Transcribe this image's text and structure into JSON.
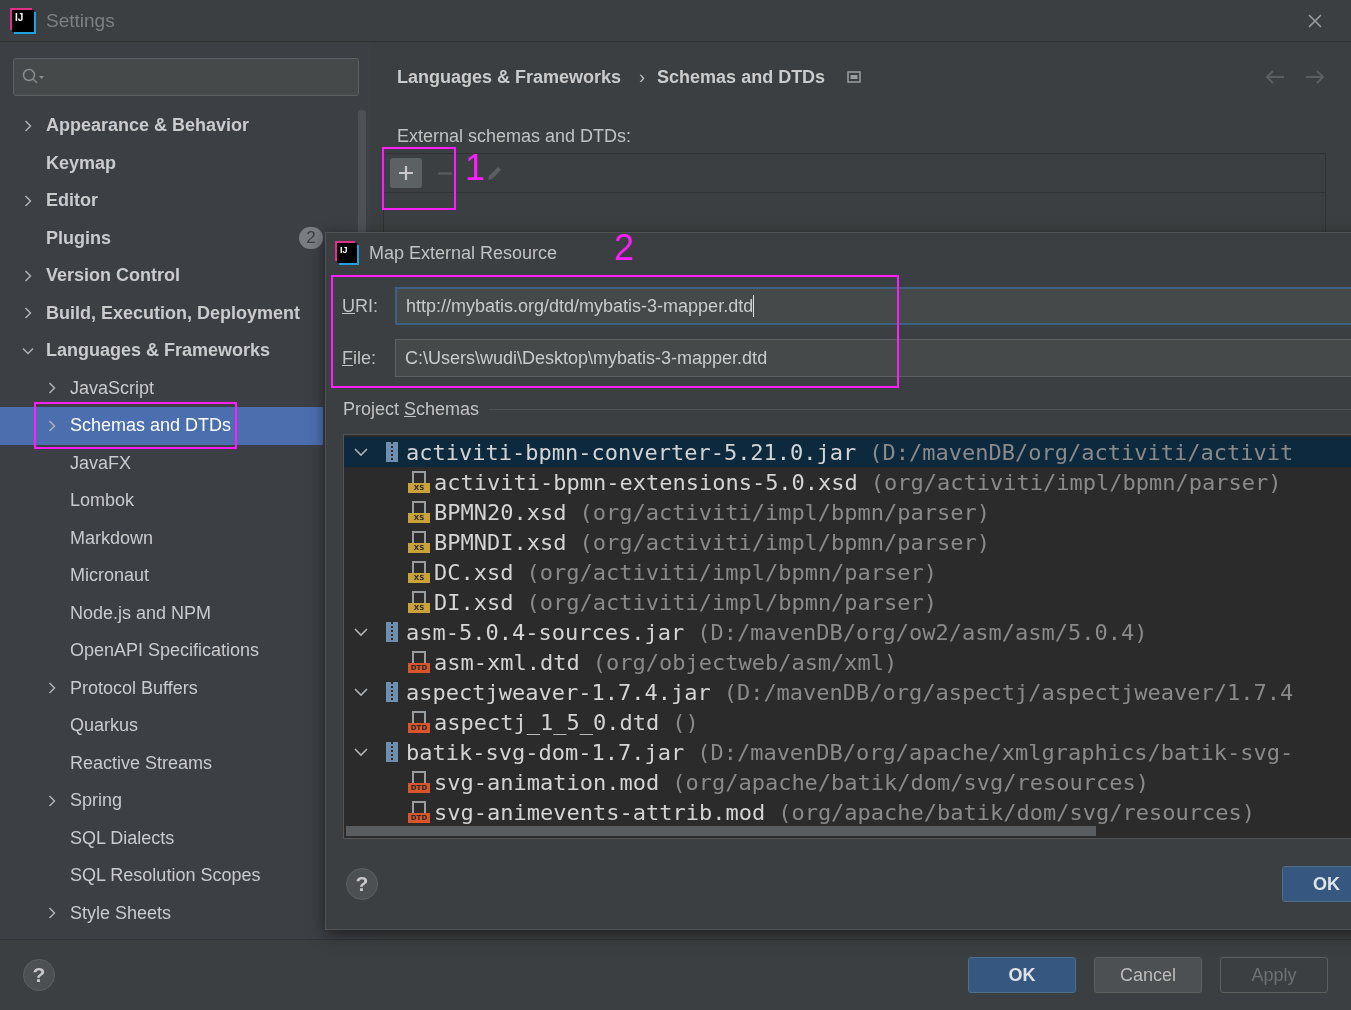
{
  "window": {
    "title": "Settings",
    "app_icon": "IJ"
  },
  "sidebar": {
    "items": [
      {
        "label": "Appearance & Behavior",
        "expandable": true,
        "expanded": false,
        "selected": false
      },
      {
        "label": "Keymap",
        "expandable": false,
        "selected": false
      },
      {
        "label": "Editor",
        "expandable": true,
        "expanded": false,
        "selected": false
      },
      {
        "label": "Plugins",
        "expandable": false,
        "selected": false,
        "badge": "2"
      },
      {
        "label": "Version Control",
        "expandable": true,
        "expanded": false,
        "selected": false
      },
      {
        "label": "Build, Execution, Deployment",
        "expandable": true,
        "expanded": false,
        "selected": false
      },
      {
        "label": "Languages & Frameworks",
        "expandable": true,
        "expanded": true,
        "selected": false,
        "children": [
          {
            "label": "JavaScript",
            "expandable": true,
            "expanded": false,
            "selected": false
          },
          {
            "label": "Schemas and DTDs",
            "expandable": true,
            "expanded": false,
            "selected": true
          },
          {
            "label": "JavaFX",
            "expandable": false,
            "selected": false
          },
          {
            "label": "Lombok",
            "expandable": false,
            "selected": false
          },
          {
            "label": "Markdown",
            "expandable": false,
            "selected": false
          },
          {
            "label": "Micronaut",
            "expandable": false,
            "selected": false
          },
          {
            "label": "Node.js and NPM",
            "expandable": false,
            "selected": false
          },
          {
            "label": "OpenAPI Specifications",
            "expandable": false,
            "selected": false
          },
          {
            "label": "Protocol Buffers",
            "expandable": true,
            "expanded": false,
            "selected": false
          },
          {
            "label": "Quarkus",
            "expandable": false,
            "selected": false
          },
          {
            "label": "Reactive Streams",
            "expandable": false,
            "selected": false
          },
          {
            "label": "Spring",
            "expandable": true,
            "expanded": false,
            "selected": false
          },
          {
            "label": "SQL Dialects",
            "expandable": false,
            "selected": false
          },
          {
            "label": "SQL Resolution Scopes",
            "expandable": false,
            "selected": false
          },
          {
            "label": "Style Sheets",
            "expandable": true,
            "expanded": false,
            "selected": false
          }
        ]
      }
    ]
  },
  "breadcrumb": {
    "items": [
      "Languages & Frameworks",
      "Schemas and DTDs"
    ],
    "separator": "›"
  },
  "external": {
    "label": "External schemas and DTDs:",
    "toolbar": [
      {
        "kind": "add",
        "disabled": false,
        "selected": true
      },
      {
        "kind": "remove",
        "disabled": true,
        "selected": false
      },
      {
        "kind": "edit",
        "disabled": true,
        "selected": false
      }
    ]
  },
  "dialog": {
    "title": "Map External Resource",
    "app_icon": "IJ",
    "fields": [
      {
        "label": "URI:",
        "value": "http://mybatis.org/dtd/mybatis-3-mapper.dtd",
        "focused": true
      },
      {
        "label": "File:",
        "value": "C:\\Users\\wudi\\Desktop\\mybatis-3-mapper.dtd",
        "focused": false
      }
    ],
    "section": {
      "before": "Project ",
      "access_key": "S",
      "after": "chemas"
    },
    "schemas": [
      {
        "name": "activiti-bpmn-converter-5.21.0.jar",
        "path": "(D:/mavenDB/org/activiti/activit",
        "expanded": true,
        "selected": true,
        "children": [
          {
            "name": "activiti-bpmn-extensions-5.0.xsd",
            "path": "(org/activiti/impl/bpmn/parser)",
            "kind": "xsd",
            "icon_label": "XS"
          },
          {
            "name": "BPMN20.xsd",
            "path": "(org/activiti/impl/bpmn/parser)",
            "kind": "xsd",
            "icon_label": "XS"
          },
          {
            "name": "BPMNDI.xsd",
            "path": "(org/activiti/impl/bpmn/parser)",
            "kind": "xsd",
            "icon_label": "XS"
          },
          {
            "name": "DC.xsd",
            "path": "(org/activiti/impl/bpmn/parser)",
            "kind": "xsd",
            "icon_label": "XS"
          },
          {
            "name": "DI.xsd",
            "path": "(org/activiti/impl/bpmn/parser)",
            "kind": "xsd",
            "icon_label": "XS"
          }
        ]
      },
      {
        "name": "asm-5.0.4-sources.jar",
        "path": "(D:/mavenDB/org/ow2/asm/asm/5.0.4)",
        "expanded": true,
        "selected": false,
        "children": [
          {
            "name": "asm-xml.dtd",
            "path": "(org/objectweb/asm/xml)",
            "kind": "dtd",
            "icon_label": "DTD"
          }
        ]
      },
      {
        "name": "aspectjweaver-1.7.4.jar",
        "path": "(D:/mavenDB/org/aspectj/aspectjweaver/1.7.4",
        "expanded": true,
        "selected": false,
        "children": [
          {
            "name": "aspectj_1_5_0.dtd",
            "path": "()",
            "kind": "dtd",
            "icon_label": "DTD"
          }
        ]
      },
      {
        "name": "batik-svg-dom-1.7.jar",
        "path": "(D:/mavenDB/org/apache/xmlgraphics/batik-svg-",
        "expanded": true,
        "selected": false,
        "children": [
          {
            "name": "svg-animation.mod",
            "path": "(org/apache/batik/dom/svg/resources)",
            "kind": "dtd",
            "icon_label": "DTD"
          },
          {
            "name": "svg-animevents-attrib.mod",
            "path": "(org/apache/batik/dom/svg/resources)",
            "kind": "dtd",
            "icon_label": "DTD"
          }
        ]
      }
    ],
    "help": "?",
    "buttons": [
      {
        "label": "OK",
        "kind": "primary",
        "disabled": false
      }
    ]
  },
  "footer": {
    "help": "?",
    "buttons": [
      {
        "label": "OK",
        "kind": "primary",
        "disabled": false
      },
      {
        "label": "Cancel",
        "kind": "normal",
        "disabled": false
      },
      {
        "label": "Apply",
        "kind": "normal",
        "disabled": true
      }
    ]
  },
  "annotations": [
    {
      "label": "1"
    },
    {
      "label": "2"
    }
  ]
}
